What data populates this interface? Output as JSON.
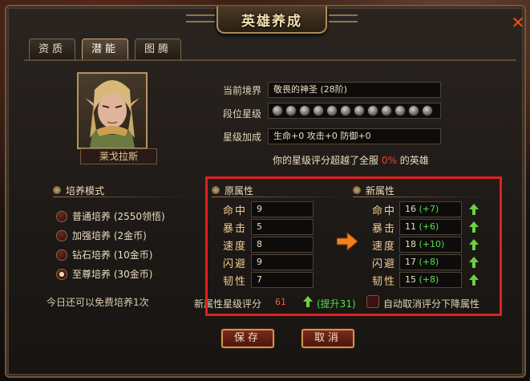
{
  "window": {
    "title": "英雄养成",
    "close_glyph": "✕"
  },
  "tabs": [
    {
      "label": "资质",
      "active": false
    },
    {
      "label": "潜能",
      "active": true
    },
    {
      "label": "图腾",
      "active": false
    }
  ],
  "hero": {
    "name": "莱戈拉斯"
  },
  "info": {
    "realm_label": "当前境界",
    "realm_value": "敬畏的神圣 (28阶)",
    "star_label": "段位星级",
    "star_count": 12,
    "bonus_label": "星级加成",
    "bonus_value": "生命+0 攻击+0 防御+0",
    "rank_prefix": "你的星级评分超越了全服",
    "rank_percent": "0%",
    "rank_suffix": "的英雄"
  },
  "mode": {
    "title": "培养模式",
    "options": [
      {
        "label": "普通培养 (2550领悟)",
        "checked": false
      },
      {
        "label": "加强培养 (2金币)",
        "checked": false
      },
      {
        "label": "钻石培养 (10金币)",
        "checked": false
      },
      {
        "label": "至尊培养 (30金币)",
        "checked": true
      }
    ],
    "free_text": "今日还可以免费培养1次"
  },
  "old_attrs": {
    "title": "原属性",
    "items": [
      {
        "label": "命中",
        "value": "9"
      },
      {
        "label": "暴击",
        "value": "5"
      },
      {
        "label": "速度",
        "value": "8"
      },
      {
        "label": "闪避",
        "value": "9"
      },
      {
        "label": "韧性",
        "value": "7"
      }
    ]
  },
  "new_attrs": {
    "title": "新属性",
    "items": [
      {
        "label": "命中",
        "value": "16",
        "delta": "(+7)"
      },
      {
        "label": "暴击",
        "value": "11",
        "delta": "(+6)"
      },
      {
        "label": "速度",
        "value": "18",
        "delta": "(+10)"
      },
      {
        "label": "闪避",
        "value": "17",
        "delta": "(+8)"
      },
      {
        "label": "韧性",
        "value": "15",
        "delta": "(+8)"
      }
    ]
  },
  "score": {
    "label": "新属性星级评分",
    "value": "61",
    "delta": "(提升31)",
    "auto_cancel_label": "自动取消评分下降属性"
  },
  "buttons": {
    "save": "保存",
    "cancel": "取消"
  },
  "colors": {
    "highlight_frame": "#e02020",
    "gain": "#50e050",
    "warn": "#f04030"
  }
}
